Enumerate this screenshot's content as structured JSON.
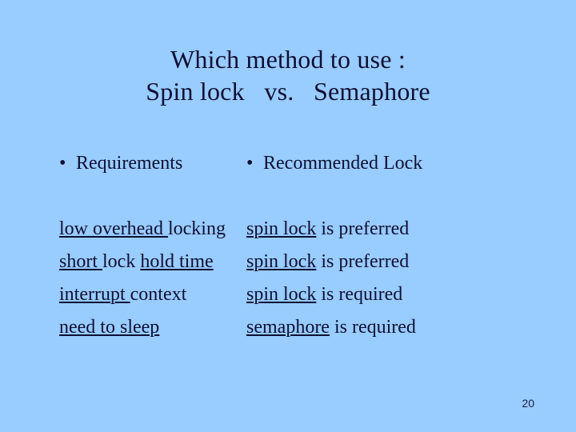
{
  "slide": {
    "background_color": "#99ccff",
    "text_color": "#0d1033",
    "page_number": "20"
  },
  "title": {
    "line1": "Which method to use :",
    "line2": "Spin lock   vs.   Semaphore"
  },
  "columns": {
    "left": {
      "bullet_glyph": "•",
      "heading": "Requirements",
      "items": [
        {
          "underlined": "low overhead ",
          "plain": "locking"
        },
        {
          "underlined": "short ",
          "plain": "lock ",
          "underlined2": "hold time"
        },
        {
          "underlined": "interrupt ",
          "plain": "context"
        },
        {
          "underlined": "need to sleep",
          "plain": ""
        }
      ]
    },
    "right": {
      "bullet_glyph": "•",
      "heading": "Recommended Lock",
      "items": [
        {
          "underlined": "spin lock",
          "plain": " is preferred"
        },
        {
          "underlined": "spin lock",
          "plain": " is preferred"
        },
        {
          "underlined": "spin lock",
          "plain": " is required"
        },
        {
          "underlined": "semaphore",
          "plain": " is required"
        }
      ]
    }
  }
}
